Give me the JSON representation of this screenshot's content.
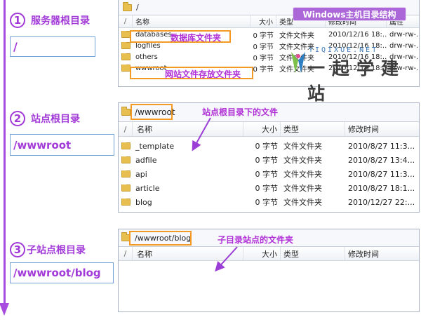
{
  "steps": [
    {
      "num": "1",
      "label": "服务器根目录",
      "path": "/"
    },
    {
      "num": "2",
      "label": "站点根目录",
      "path": "/wwwroot"
    },
    {
      "num": "3",
      "label": "子站点根目录",
      "path": "/wwwroot/blog"
    }
  ],
  "panel1": {
    "path": "/",
    "headers": [
      "名称",
      "大小",
      "类型",
      "修改时间",
      "属性"
    ],
    "rows": [
      {
        "name": "databases",
        "size": "0 字节",
        "type": "文件文件夹",
        "time": "2010/12/16 18:...",
        "attr": "drw-rw-..."
      },
      {
        "name": "logfiles",
        "size": "0 字节",
        "type": "文件文件夹",
        "time": "2010/12/16 18:...",
        "attr": "drw-rw-..."
      },
      {
        "name": "others",
        "size": "0 字节",
        "type": "文件文件夹",
        "time": "2010/12/16 18:...",
        "attr": "drw-rw-..."
      },
      {
        "name": "wwwroot",
        "size": "0 字节",
        "type": "文件文件夹",
        "time": "2010/12/16 18:...",
        "attr": "drw-rw-..."
      }
    ]
  },
  "panel2": {
    "path": "/wwwroot",
    "headers": [
      "名称",
      "大小",
      "类型",
      "修改时间"
    ],
    "rows": [
      {
        "name": "_template",
        "size": "0 字节",
        "type": "文件文件夹",
        "time": "2010/8/27 11:3..."
      },
      {
        "name": "adfile",
        "size": "0 字节",
        "type": "文件文件夹",
        "time": "2010/8/27 13:4..."
      },
      {
        "name": "api",
        "size": "0 字节",
        "type": "文件文件夹",
        "time": "2010/8/27 11:3..."
      },
      {
        "name": "article",
        "size": "0 字节",
        "type": "文件文件夹",
        "time": "2010/8/27 18:1..."
      },
      {
        "name": "blog",
        "size": "0 字节",
        "type": "文件文件夹",
        "time": "2010/12/27 22:..."
      }
    ]
  },
  "panel3": {
    "path": "/wwwroot/blog",
    "headers": [
      "名称",
      "大小",
      "类型",
      "修改时间"
    ]
  },
  "annotations": {
    "windows_badge": "Windows主机目录结构",
    "db_folder": "数据库文件夹",
    "web_folder": "网站文件存放文件夹",
    "site_root_files": "站点根目录下的文件",
    "subsite_folder": "子目录站点的文件夹"
  },
  "logo": {
    "en": "YIQIXUE.NET",
    "cn": "一起学建站"
  },
  "colors": {
    "accent": "#a23ad8",
    "highlight": "#f39a24",
    "badge": "#ab66d8"
  }
}
